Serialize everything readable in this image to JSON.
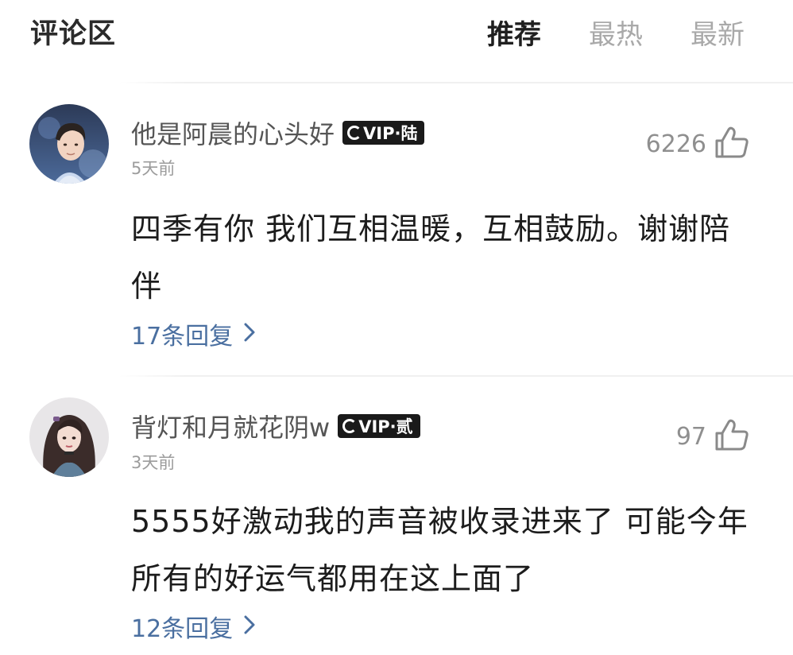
{
  "header": {
    "title": "评论区",
    "tabs": [
      {
        "label": "推荐",
        "active": true
      },
      {
        "label": "最热",
        "active": false
      },
      {
        "label": "最新",
        "active": false
      }
    ]
  },
  "comments": [
    {
      "username": "他是阿晨的心头好",
      "vip_badge": "VIP·陆",
      "time": "5天前",
      "likes": "6226",
      "text": "四季有你 我们互相温暖，互相鼓励。谢谢陪伴",
      "replies_label": "17条回复",
      "avatar_icon": "male-avatar-icon"
    },
    {
      "username": "背灯和月就花阴w",
      "vip_badge": "VIP·贰",
      "time": "3天前",
      "likes": "97",
      "text": "5555好激动我的声音被收录进来了 可能今年所有的好运气都用在这上面了",
      "replies_label": "12条回复",
      "avatar_icon": "female-avatar-icon"
    }
  ],
  "colors": {
    "reply_link": "#4a6fa0",
    "badge_bg": "#1a1a1a",
    "muted_text": "#9c9c9c"
  }
}
